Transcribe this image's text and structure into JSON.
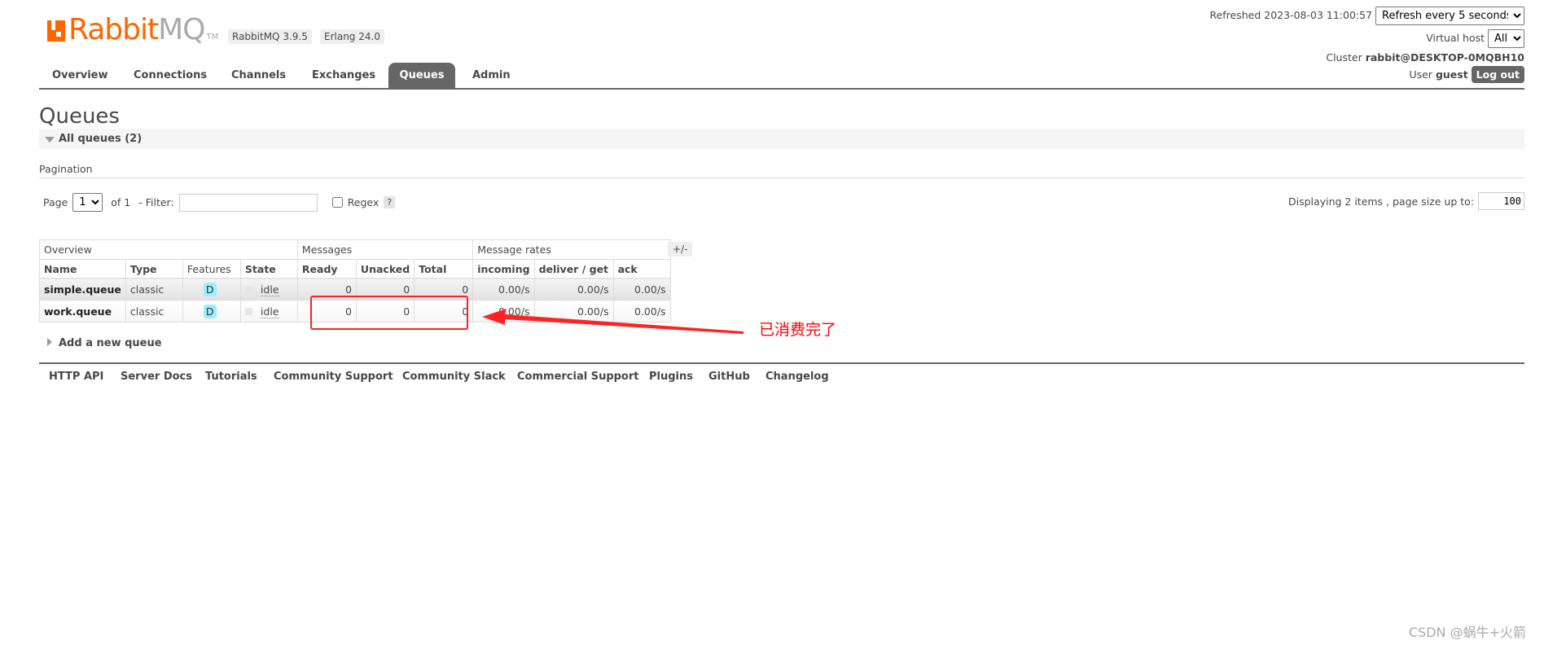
{
  "header": {
    "logo_text_1": "Rabbit",
    "logo_text_2": "MQ",
    "logo_tm": "TM",
    "version_badge": "RabbitMQ 3.9.5",
    "erlang_badge": "Erlang 24.0"
  },
  "tabs": [
    {
      "label": "Overview"
    },
    {
      "label": "Connections"
    },
    {
      "label": "Channels"
    },
    {
      "label": "Exchanges"
    },
    {
      "label": "Queues",
      "active": true
    },
    {
      "label": "Admin"
    }
  ],
  "status": {
    "refreshed": "Refreshed 2023-08-03 11:00:57",
    "refresh_option": "Refresh every 5 seconds",
    "vhost_label": "Virtual host",
    "vhost_value": "All",
    "cluster_label": "Cluster",
    "cluster_name": "rabbit@DESKTOP-0MQBH10",
    "user_label": "User",
    "user_name": "guest",
    "logout": "Log out"
  },
  "page": {
    "title": "Queues",
    "section": "All queues (2)",
    "pagination_label": "Pagination",
    "page_label": "Page",
    "page_value": "1",
    "of": "of 1",
    "filter_label": "- Filter:",
    "filter_value": "",
    "regex_label": "Regex",
    "help": "?",
    "displaying": "Displaying 2 items , page size up to:",
    "page_size": "100"
  },
  "table": {
    "groups": [
      "Overview",
      "Messages",
      "Message rates"
    ],
    "plusminus": "+/-",
    "columns": [
      "Name",
      "Type",
      "Features",
      "State",
      "Ready",
      "Unacked",
      "Total",
      "incoming",
      "deliver / get",
      "ack"
    ],
    "rows": [
      {
        "name": "simple.queue",
        "type": "classic",
        "feature": "D",
        "state": "idle",
        "ready": "0",
        "unacked": "0",
        "total": "0",
        "incoming": "0.00/s",
        "deliver": "0.00/s",
        "ack": "0.00/s"
      },
      {
        "name": "work.queue",
        "type": "classic",
        "feature": "D",
        "state": "idle",
        "ready": "0",
        "unacked": "0",
        "total": "0",
        "incoming": "0.00/s",
        "deliver": "0.00/s",
        "ack": "0.00/s"
      }
    ]
  },
  "add_queue": "Add a new queue",
  "annotation": {
    "text": "已消费完了",
    "color": "#ff0000"
  },
  "footer": [
    "HTTP API",
    "Server Docs",
    "Tutorials",
    "Community Support",
    "Community Slack",
    "Commercial Support",
    "Plugins",
    "GitHub",
    "Changelog"
  ],
  "watermark": "CSDN @蜗牛+火箭",
  "colors": {
    "brand": "#ff6600",
    "tab_active": "#666666"
  }
}
